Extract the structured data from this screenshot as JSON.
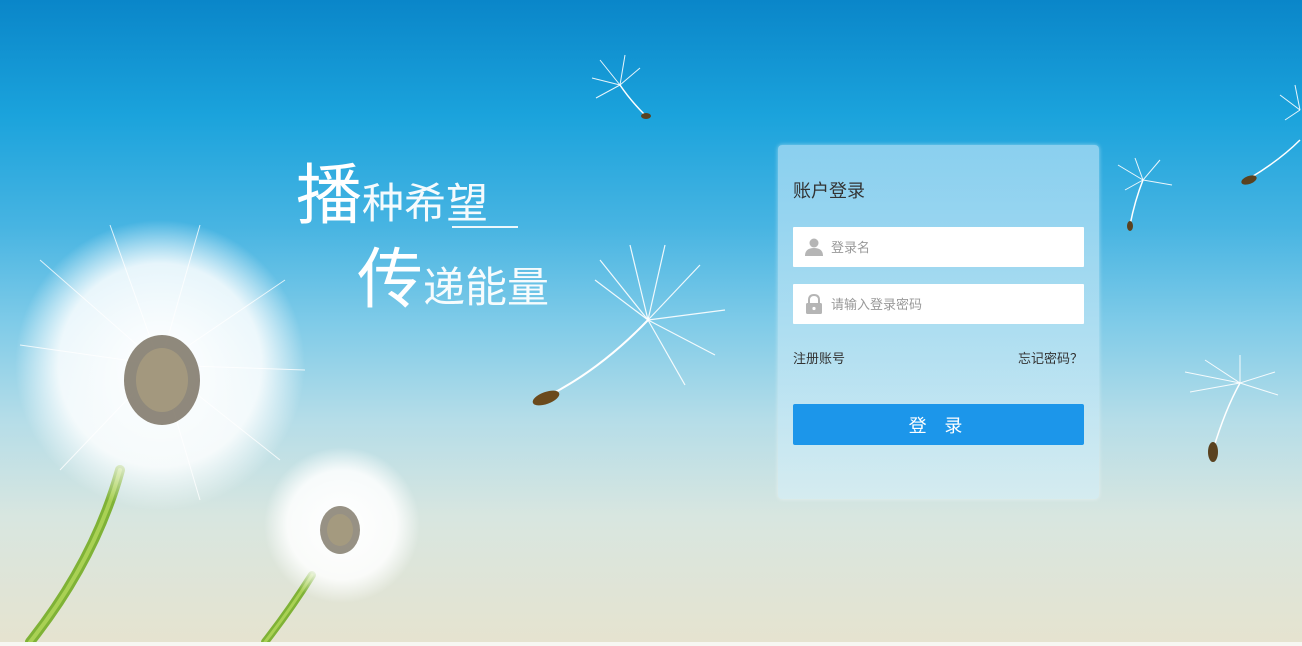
{
  "slogan": {
    "line1_big": "播",
    "line1_rest": "种希望",
    "line2_big": "传",
    "line2_rest": "递能量"
  },
  "login": {
    "title": "账户登录",
    "username_placeholder": "登录名",
    "password_placeholder": "请输入登录密码",
    "register_link": "注册账号",
    "forgot_link": "忘记密码？",
    "submit_label": "登 录"
  },
  "colors": {
    "button": "#1c96ea",
    "sky_top": "#0a86c9",
    "sky_bottom": "#e6e3cf"
  },
  "icons": {
    "user": "user-icon",
    "lock": "lock-icon"
  }
}
